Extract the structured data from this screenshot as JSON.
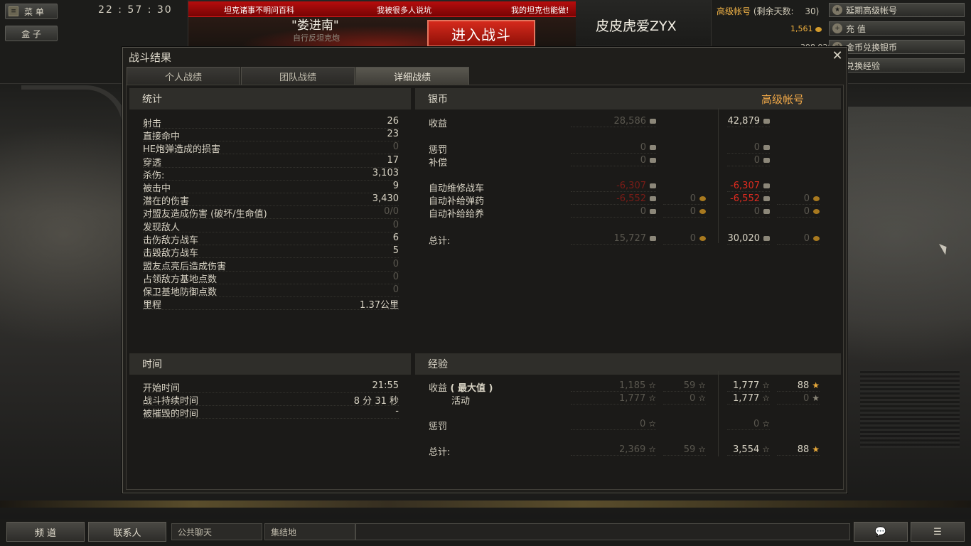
{
  "top": {
    "menu_label": "菜 单",
    "box_label": "盒 子",
    "clock": "22 : 57 : 30",
    "tickers": [
      "坦克诸事不明问百科",
      "我被很多人说坑",
      "我的坦克也能做!"
    ],
    "tank_name": "\"娄进南\"",
    "tank_type": "自行反坦克炮",
    "battle_button": "进入战斗",
    "player_name": "皮皮虎爱ZYX",
    "premium_label": "高级帐号",
    "premium_days_text": "(剩余天数:",
    "premium_days": "30)",
    "gold": "1,561",
    "silver": "398,928",
    "buttons": {
      "extend_premium": "延期高级帐号",
      "recharge": "充 值",
      "exchange_silver": "金币兑换银币",
      "exchange_exp": "兑换经验"
    }
  },
  "dialog": {
    "title": "战斗结果",
    "tabs": [
      "个人战绩",
      "团队战绩",
      "详细战绩"
    ],
    "active_tab": 2,
    "stats": {
      "header": "统计",
      "rows": [
        {
          "label": "射击",
          "value": "26",
          "dim": false
        },
        {
          "label": "直接命中",
          "value": "23",
          "dim": false
        },
        {
          "label": "HE炮弹造成的损害",
          "value": "0",
          "dim": true
        },
        {
          "label": "穿透",
          "value": "17",
          "dim": false
        },
        {
          "label": "杀伤:",
          "value": "3,103",
          "dim": false
        },
        {
          "label": "被击中",
          "value": "9",
          "dim": false
        },
        {
          "label": "潜在的伤害",
          "value": "3,430",
          "dim": false
        },
        {
          "label": "对盟友造成伤害 (破坏/生命值)",
          "value": "0/0",
          "dim": true
        },
        {
          "label": "发现敌人",
          "value": "0",
          "dim": true
        },
        {
          "label": "击伤敌方战车",
          "value": "6",
          "dim": false
        },
        {
          "label": "击毁敌方战车",
          "value": "5",
          "dim": false
        },
        {
          "label": "盟友点亮后造成伤害",
          "value": "0",
          "dim": true
        },
        {
          "label": "占领敌方基地点数",
          "value": "0",
          "dim": true
        },
        {
          "label": "保卫基地防御点数",
          "value": "0",
          "dim": true
        },
        {
          "label": "里程",
          "value": "1.37公里",
          "dim": false
        }
      ]
    },
    "time": {
      "header": "时间",
      "rows": [
        {
          "label": "开始时间",
          "value": "21:55"
        },
        {
          "label": "战斗持续时间",
          "value": "8 分 31 秒"
        },
        {
          "label": "被摧毁的时间",
          "value": "-"
        }
      ]
    },
    "credits": {
      "header": "银币",
      "premium_header": "高级帐号",
      "rows": [
        {
          "label": "收益",
          "base": "28,586",
          "base_gold": "",
          "prem": "42,879",
          "prem_gold": ""
        },
        {
          "label": "惩罚",
          "base": "0",
          "base_gold": "",
          "prem": "0",
          "prem_gold": ""
        },
        {
          "label": "补偿",
          "base": "0",
          "base_gold": "",
          "prem": "0",
          "prem_gold": ""
        },
        {
          "label": "自动维修战车",
          "base": "-6,307",
          "base_gold": "",
          "prem": "-6,307",
          "prem_gold": ""
        },
        {
          "label": "自动补给弹药",
          "base": "-6,552",
          "base_gold": "0",
          "prem": "-6,552",
          "prem_gold": "0"
        },
        {
          "label": "自动补给给养",
          "base": "0",
          "base_gold": "0",
          "prem": "0",
          "prem_gold": "0"
        },
        {
          "label": "总计:",
          "base": "15,727",
          "base_gold": "0",
          "prem": "30,020",
          "prem_gold": "0"
        }
      ]
    },
    "experience": {
      "header": "经验",
      "rows": [
        {
          "label": "收益",
          "label_bold": "( 最大值 )",
          "base": "1,185",
          "base_free": "59",
          "prem": "1,777",
          "prem_free": "88"
        },
        {
          "label": "活动",
          "label_bold": "",
          "base": "1,777",
          "base_free": "0",
          "prem": "1,777",
          "prem_free": "0"
        },
        {
          "label": "惩罚",
          "label_bold": "",
          "base": "0",
          "base_free": "",
          "prem": "0",
          "prem_free": ""
        },
        {
          "label": "总计:",
          "label_bold": "",
          "base": "2,369",
          "base_free": "59",
          "prem": "3,554",
          "prem_free": "88"
        }
      ]
    }
  },
  "bottom": {
    "channels": "频 道",
    "contacts": "联系人",
    "chat_tabs": [
      "公共聊天",
      "集结地"
    ]
  }
}
